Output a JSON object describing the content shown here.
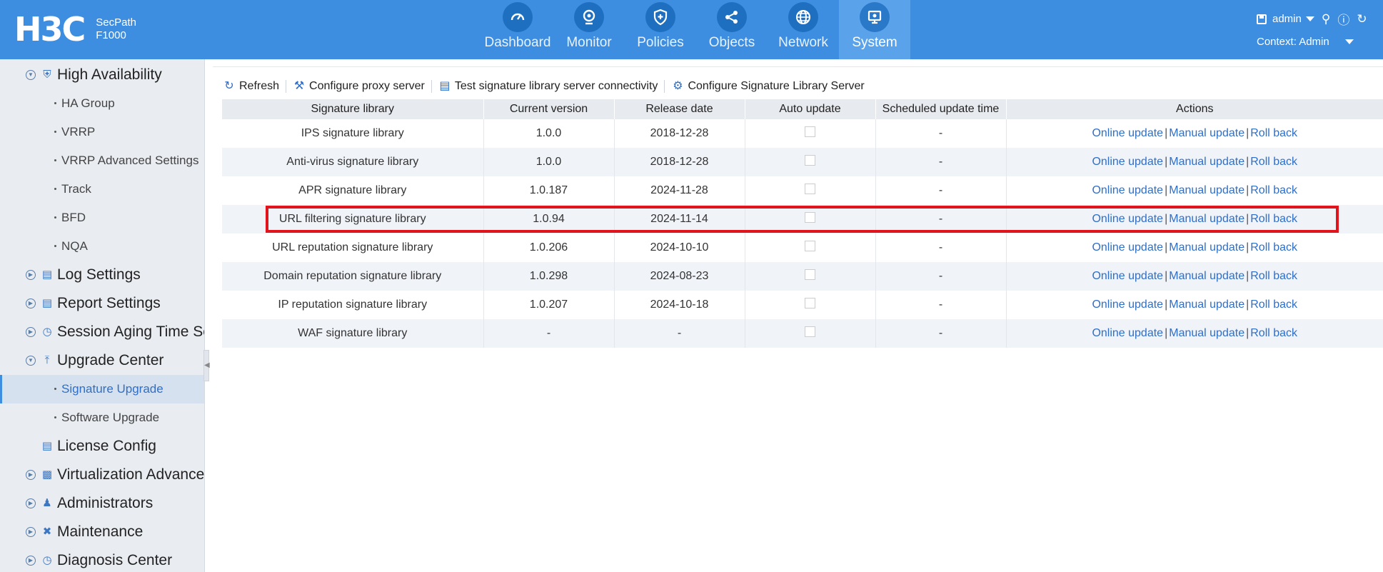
{
  "brand": {
    "logo": "H3C",
    "product_line1": "SecPath",
    "product_line2": "F1000"
  },
  "nav": [
    {
      "label": "Dashboard",
      "icon": "dashboard-gauge-icon"
    },
    {
      "label": "Monitor",
      "icon": "monitor-camera-icon"
    },
    {
      "label": "Policies",
      "icon": "shield-icon"
    },
    {
      "label": "Objects",
      "icon": "share-nodes-icon"
    },
    {
      "label": "Network",
      "icon": "globe-icon"
    },
    {
      "label": "System",
      "icon": "system-monitor-icon",
      "active": true
    }
  ],
  "user": {
    "name": "admin",
    "context": "Context: Admin"
  },
  "sidebar": {
    "high_availability": "High Availability",
    "ha_group": "HA Group",
    "vrrp": "VRRP",
    "vrrp_adv": "VRRP Advanced Settings",
    "track": "Track",
    "bfd": "BFD",
    "nqa": "NQA",
    "log_settings": "Log Settings",
    "report_settings": "Report Settings",
    "session_aging": "Session Aging Time Se",
    "upgrade_center": "Upgrade Center",
    "signature_upgrade": "Signature Upgrade",
    "software_upgrade": "Software Upgrade",
    "license_config": "License Config",
    "virtualization": "Virtualization Advance",
    "administrators": "Administrators",
    "maintenance": "Maintenance",
    "diagnosis": "Diagnosis Center"
  },
  "toolbar": {
    "refresh": "Refresh",
    "proxy": "Configure proxy server",
    "test": "Test signature library server connectivity",
    "configure_server": "Configure Signature Library Server"
  },
  "table": {
    "headers": [
      "Signature library",
      "Current version",
      "Release date",
      "Auto update",
      "Scheduled update time",
      "Actions"
    ],
    "actions": {
      "online": "Online update",
      "manual": "Manual update",
      "rollback": "Roll back"
    },
    "rows": [
      {
        "library": "IPS signature library",
        "version": "1.0.0",
        "date": "2018-12-28",
        "schedule": "-"
      },
      {
        "library": "Anti-virus signature library",
        "version": "1.0.0",
        "date": "2018-12-28",
        "schedule": "-"
      },
      {
        "library": "APR signature library",
        "version": "1.0.187",
        "date": "2024-11-28",
        "schedule": "-"
      },
      {
        "library": "URL filtering signature library",
        "version": "1.0.94",
        "date": "2024-11-14",
        "schedule": "-"
      },
      {
        "library": "URL reputation signature library",
        "version": "1.0.206",
        "date": "2024-10-10",
        "schedule": "-"
      },
      {
        "library": "Domain reputation signature library",
        "version": "1.0.298",
        "date": "2024-08-23",
        "schedule": "-"
      },
      {
        "library": "IP reputation signature library",
        "version": "1.0.207",
        "date": "2024-10-18",
        "schedule": "-"
      },
      {
        "library": "WAF signature library",
        "version": "-",
        "date": "-",
        "schedule": "-"
      }
    ]
  },
  "colors": {
    "topbar": "#3d8ee0",
    "link": "#2e6fc9",
    "highlight": "#e0141c"
  }
}
